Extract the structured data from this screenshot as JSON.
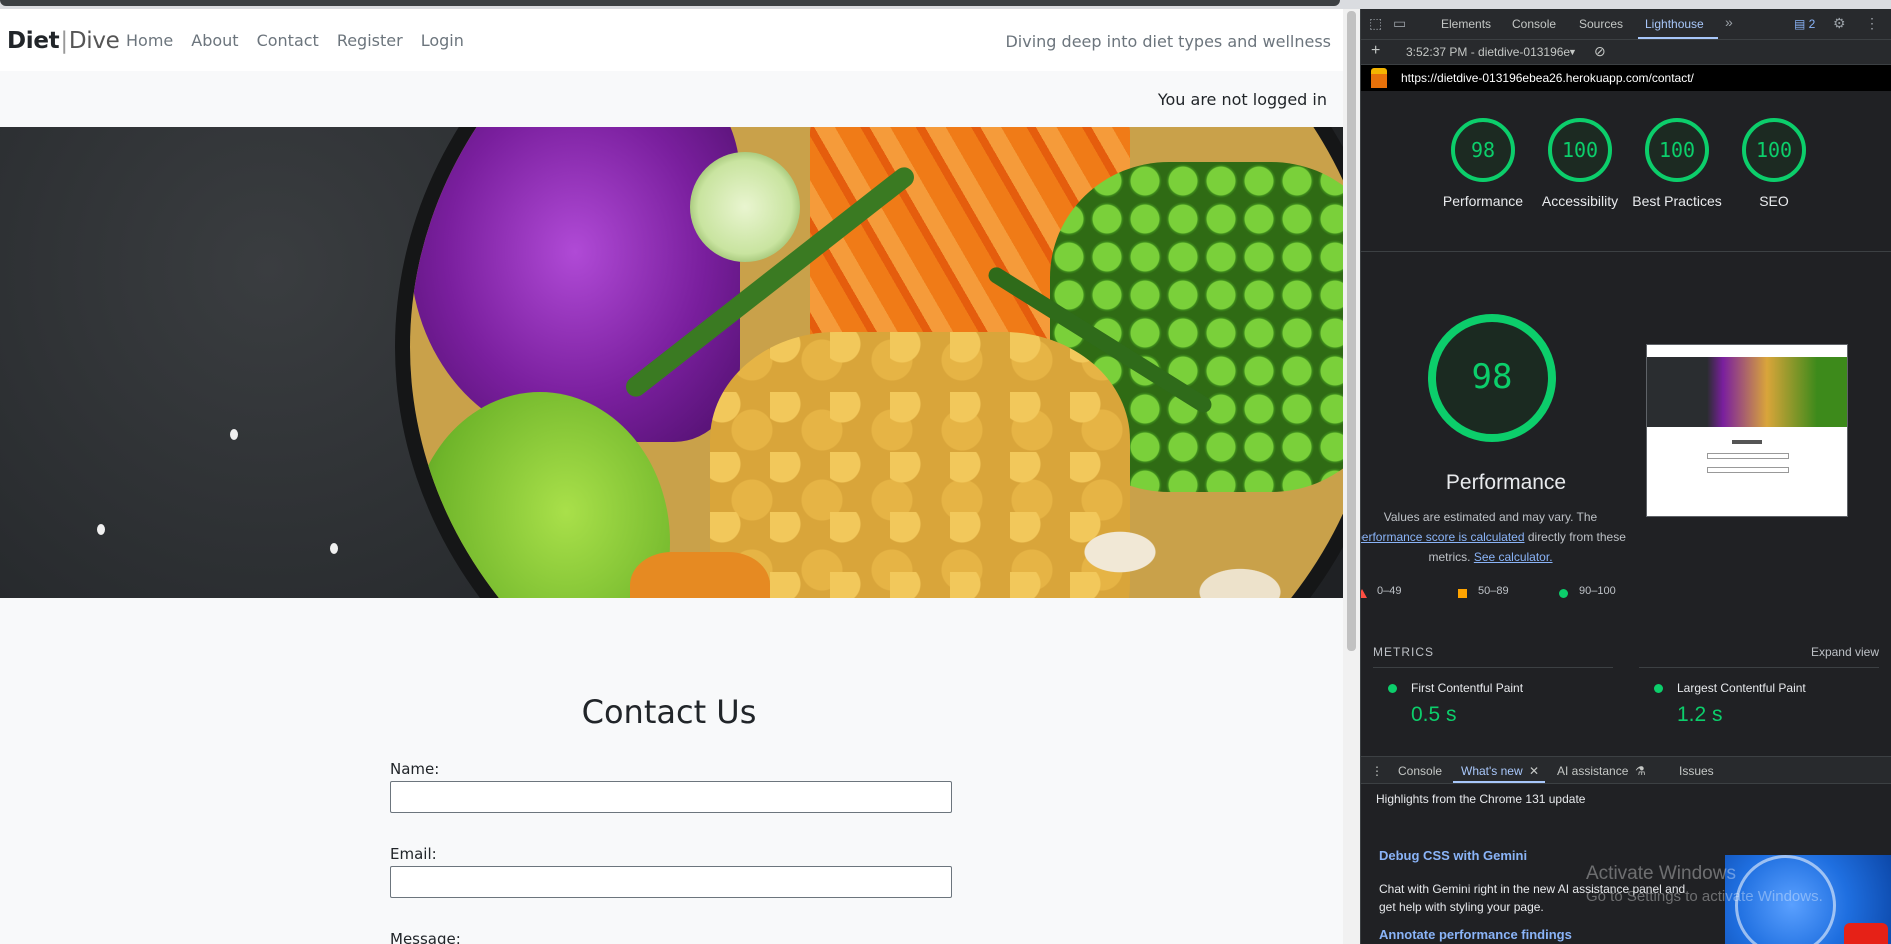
{
  "site": {
    "brand_part1": "Diet",
    "brand_sep": "|",
    "brand_part2": "Dive",
    "nav": [
      "Home",
      "About",
      "Contact",
      "Register",
      "Login"
    ],
    "tagline": "Diving deep into diet types and wellness",
    "login_status": "You are not logged in",
    "contact_title": "Contact Us",
    "form": {
      "name_label": "Name:",
      "email_label": "Email:",
      "message_label": "Message:",
      "name_value": "",
      "email_value": ""
    }
  },
  "devtools": {
    "tabs": [
      "Elements",
      "Console",
      "Sources",
      "Lighthouse"
    ],
    "active_tab": "Lighthouse",
    "more_icon": "chevron-double-right-icon",
    "issues_badge": "2",
    "report_time": "3:52:37 PM - dietdive-013196e",
    "url": "https://dietdive-013196ebea26.herokuapp.com/contact/",
    "scores": [
      {
        "label": "Performance",
        "value": "98"
      },
      {
        "label": "Accessibility",
        "value": "100"
      },
      {
        "label": "Best Practices",
        "value": "100"
      },
      {
        "label": "SEO",
        "value": "100"
      }
    ],
    "main_score": "98",
    "main_title": "Performance",
    "desc_line1": "Values are estimated and may vary. The",
    "desc_link1": "performance score is calculated",
    "desc_line2_rest": " directly from these",
    "desc_line3": "metrics. ",
    "desc_link2": "See calculator.",
    "legend": [
      {
        "range": "0–49",
        "color": "#ff4e42"
      },
      {
        "range": "50–89",
        "color": "#ffa400"
      },
      {
        "range": "90–100",
        "color": "#0cce6b"
      }
    ],
    "metrics_heading": "METRICS",
    "expand_label": "Expand view",
    "metrics": [
      {
        "name": "First Contentful Paint",
        "value": "0.5 s"
      },
      {
        "name": "Largest Contentful Paint",
        "value": "1.2 s"
      }
    ],
    "drawer_tabs": [
      "Console",
      "What's new",
      "AI assistance",
      "Issues"
    ],
    "drawer_active": "What's new",
    "highlights": "Highlights from the Chrome 131 update",
    "whats_new": [
      {
        "title": "Debug CSS with Gemini",
        "body": "Chat with Gemini right in the new AI assistance panel and get help with styling your page."
      },
      {
        "title": "Annotate performance findings"
      }
    ],
    "watermark_line1": "Activate Windows",
    "watermark_line2": "Go to Settings to activate Windows."
  },
  "colors": {
    "good": "#0cce6b",
    "link": "#8ab4f8",
    "devtools_bg": "#202124"
  }
}
